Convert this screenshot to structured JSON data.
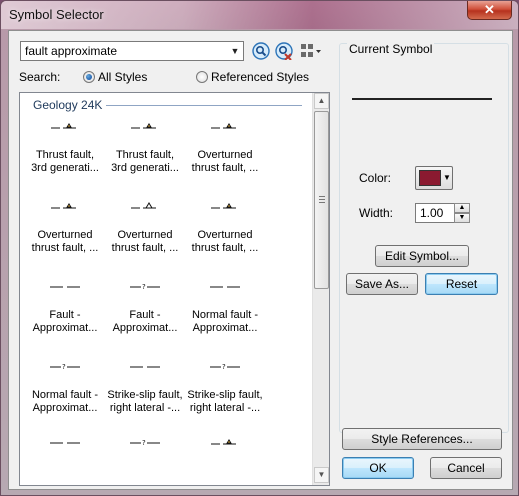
{
  "window": {
    "title": "Symbol Selector",
    "close_glyph": "✕"
  },
  "search": {
    "value": "fault approximate",
    "label": "Search:",
    "options": [
      "All Styles",
      "Referenced Styles"
    ],
    "selected": "All Styles"
  },
  "toolbar_icons": [
    "search-icon",
    "clear-search-icon",
    "view-options-icon"
  ],
  "symbol_group": {
    "title": "Geology 24K",
    "items": [
      {
        "label": [
          "Thrust fault,",
          "3rd generati..."
        ],
        "glyph": "thrust-triangle"
      },
      {
        "label": [
          "Thrust fault,",
          "3rd generati..."
        ],
        "glyph": "thrust-triangle"
      },
      {
        "label": [
          "Overturned",
          "thrust fault, ..."
        ],
        "glyph": "thrust-triangle"
      },
      {
        "label": [
          "Overturned",
          "thrust fault, ..."
        ],
        "glyph": "thrust-triangle"
      },
      {
        "label": [
          "Overturned",
          "thrust fault, ..."
        ],
        "glyph": "thrust-triangle-open"
      },
      {
        "label": [
          "Overturned",
          "thrust fault, ..."
        ],
        "glyph": "thrust-triangle"
      },
      {
        "label": [
          "Fault -",
          "Approximat..."
        ],
        "glyph": "dashed"
      },
      {
        "label": [
          "Fault -",
          "Approximat..."
        ],
        "glyph": "dashed-query"
      },
      {
        "label": [
          "Normal fault -",
          "Approximat..."
        ],
        "glyph": "dashed"
      },
      {
        "label": [
          "Normal fault -",
          "Approximat..."
        ],
        "glyph": "dashed-query"
      },
      {
        "label": [
          "Strike-slip fault,",
          "right lateral -..."
        ],
        "glyph": "dashed"
      },
      {
        "label": [
          "Strike-slip fault,",
          "right lateral -..."
        ],
        "glyph": "dashed-query"
      },
      {
        "label": [
          "",
          ""
        ],
        "glyph": "dashed"
      },
      {
        "label": [
          "",
          ""
        ],
        "glyph": "dashed-query"
      },
      {
        "label": [
          "",
          ""
        ],
        "glyph": "thrust-triangle"
      }
    ]
  },
  "current_symbol": {
    "caption": "Current Symbol",
    "color_label": "Color:",
    "color": "#8b1a30",
    "width_label": "Width:",
    "width_value": "1.00",
    "edit_button": "Edit Symbol...",
    "save_as_button": "Save As...",
    "reset_button": "Reset"
  },
  "footer": {
    "style_references_button": "Style References...",
    "ok_button": "OK",
    "cancel_button": "Cancel"
  }
}
